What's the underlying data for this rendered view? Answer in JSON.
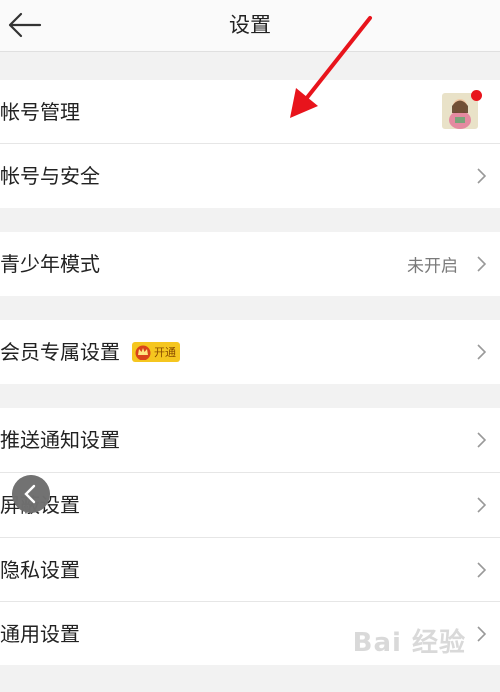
{
  "header": {
    "title": "设置"
  },
  "items": [
    {
      "label": "帐号管理"
    },
    {
      "label": "帐号与安全"
    },
    {
      "label": "青少年模式",
      "value": "未开启"
    },
    {
      "label": "会员专属设置",
      "badge": "开通"
    },
    {
      "label": "推送通知设置"
    },
    {
      "label": "屏蔽设置"
    },
    {
      "label": "隐私设置"
    },
    {
      "label": "通用设置"
    }
  ],
  "icons": {
    "back": "arrow-left-icon",
    "chevron": "chevron-right-icon",
    "crown": "crown-icon"
  },
  "colors": {
    "annotation_arrow": "#e8141c",
    "badge": "#f5c61f",
    "notification_dot": "#e8141c"
  },
  "watermark": "Bai 经验"
}
